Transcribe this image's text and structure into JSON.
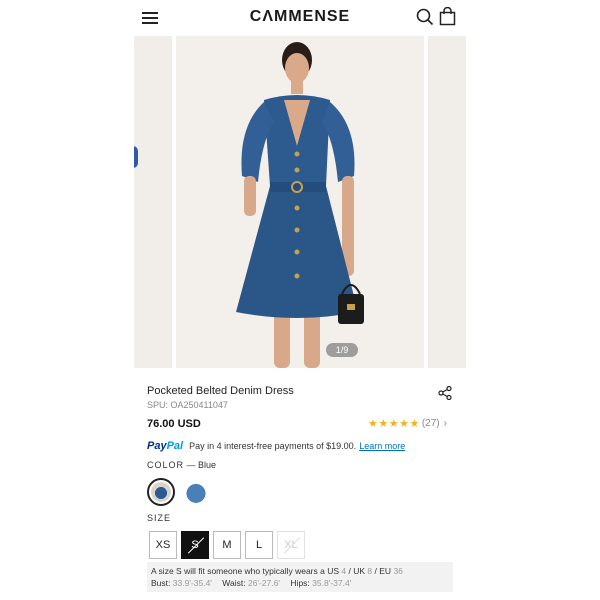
{
  "header": {
    "logo": "CΛMMENSE"
  },
  "gallery": {
    "counter": "1/9"
  },
  "product": {
    "title": "Pocketed Belted Denim Dress",
    "spu": "SPU: OA250411047",
    "price": "76.00 USD",
    "rating": {
      "stars": 4.5,
      "stars_text": "★★★★★",
      "count": "(27)"
    }
  },
  "paypal": {
    "logo_p": "Pay",
    "logo_pal": "Pal",
    "text": "Pay in 4 interest-free payments of $19.00.",
    "link": "Learn more"
  },
  "color": {
    "label": "COLOR",
    "separator": " — ",
    "value": "Blue"
  },
  "size": {
    "label": "SIZE",
    "options": [
      {
        "label": "XS",
        "state": "normal"
      },
      {
        "label": "S",
        "state": "selected"
      },
      {
        "label": "M",
        "state": "normal"
      },
      {
        "label": "L",
        "state": "normal"
      },
      {
        "label": "XL",
        "state": "disabled"
      }
    ]
  },
  "fit": {
    "intro": "A size S will fit someone who typically wears a US",
    "us": "4",
    "uk_label": "/ UK",
    "uk": "8",
    "eu_label": "/ EU",
    "eu": "36",
    "bust_label": "Bust:",
    "bust": "33.9'-35.4'",
    "waist_label": "Waist:",
    "waist": "26'-27.6'",
    "hips_label": "Hips:",
    "hips": "35.8'-37.4'"
  },
  "colors": {
    "accent": "#111111",
    "paypal_blue": "#003087",
    "paypal_light": "#009cde",
    "star": "#f2b418",
    "denim": "#2d5a8f"
  }
}
